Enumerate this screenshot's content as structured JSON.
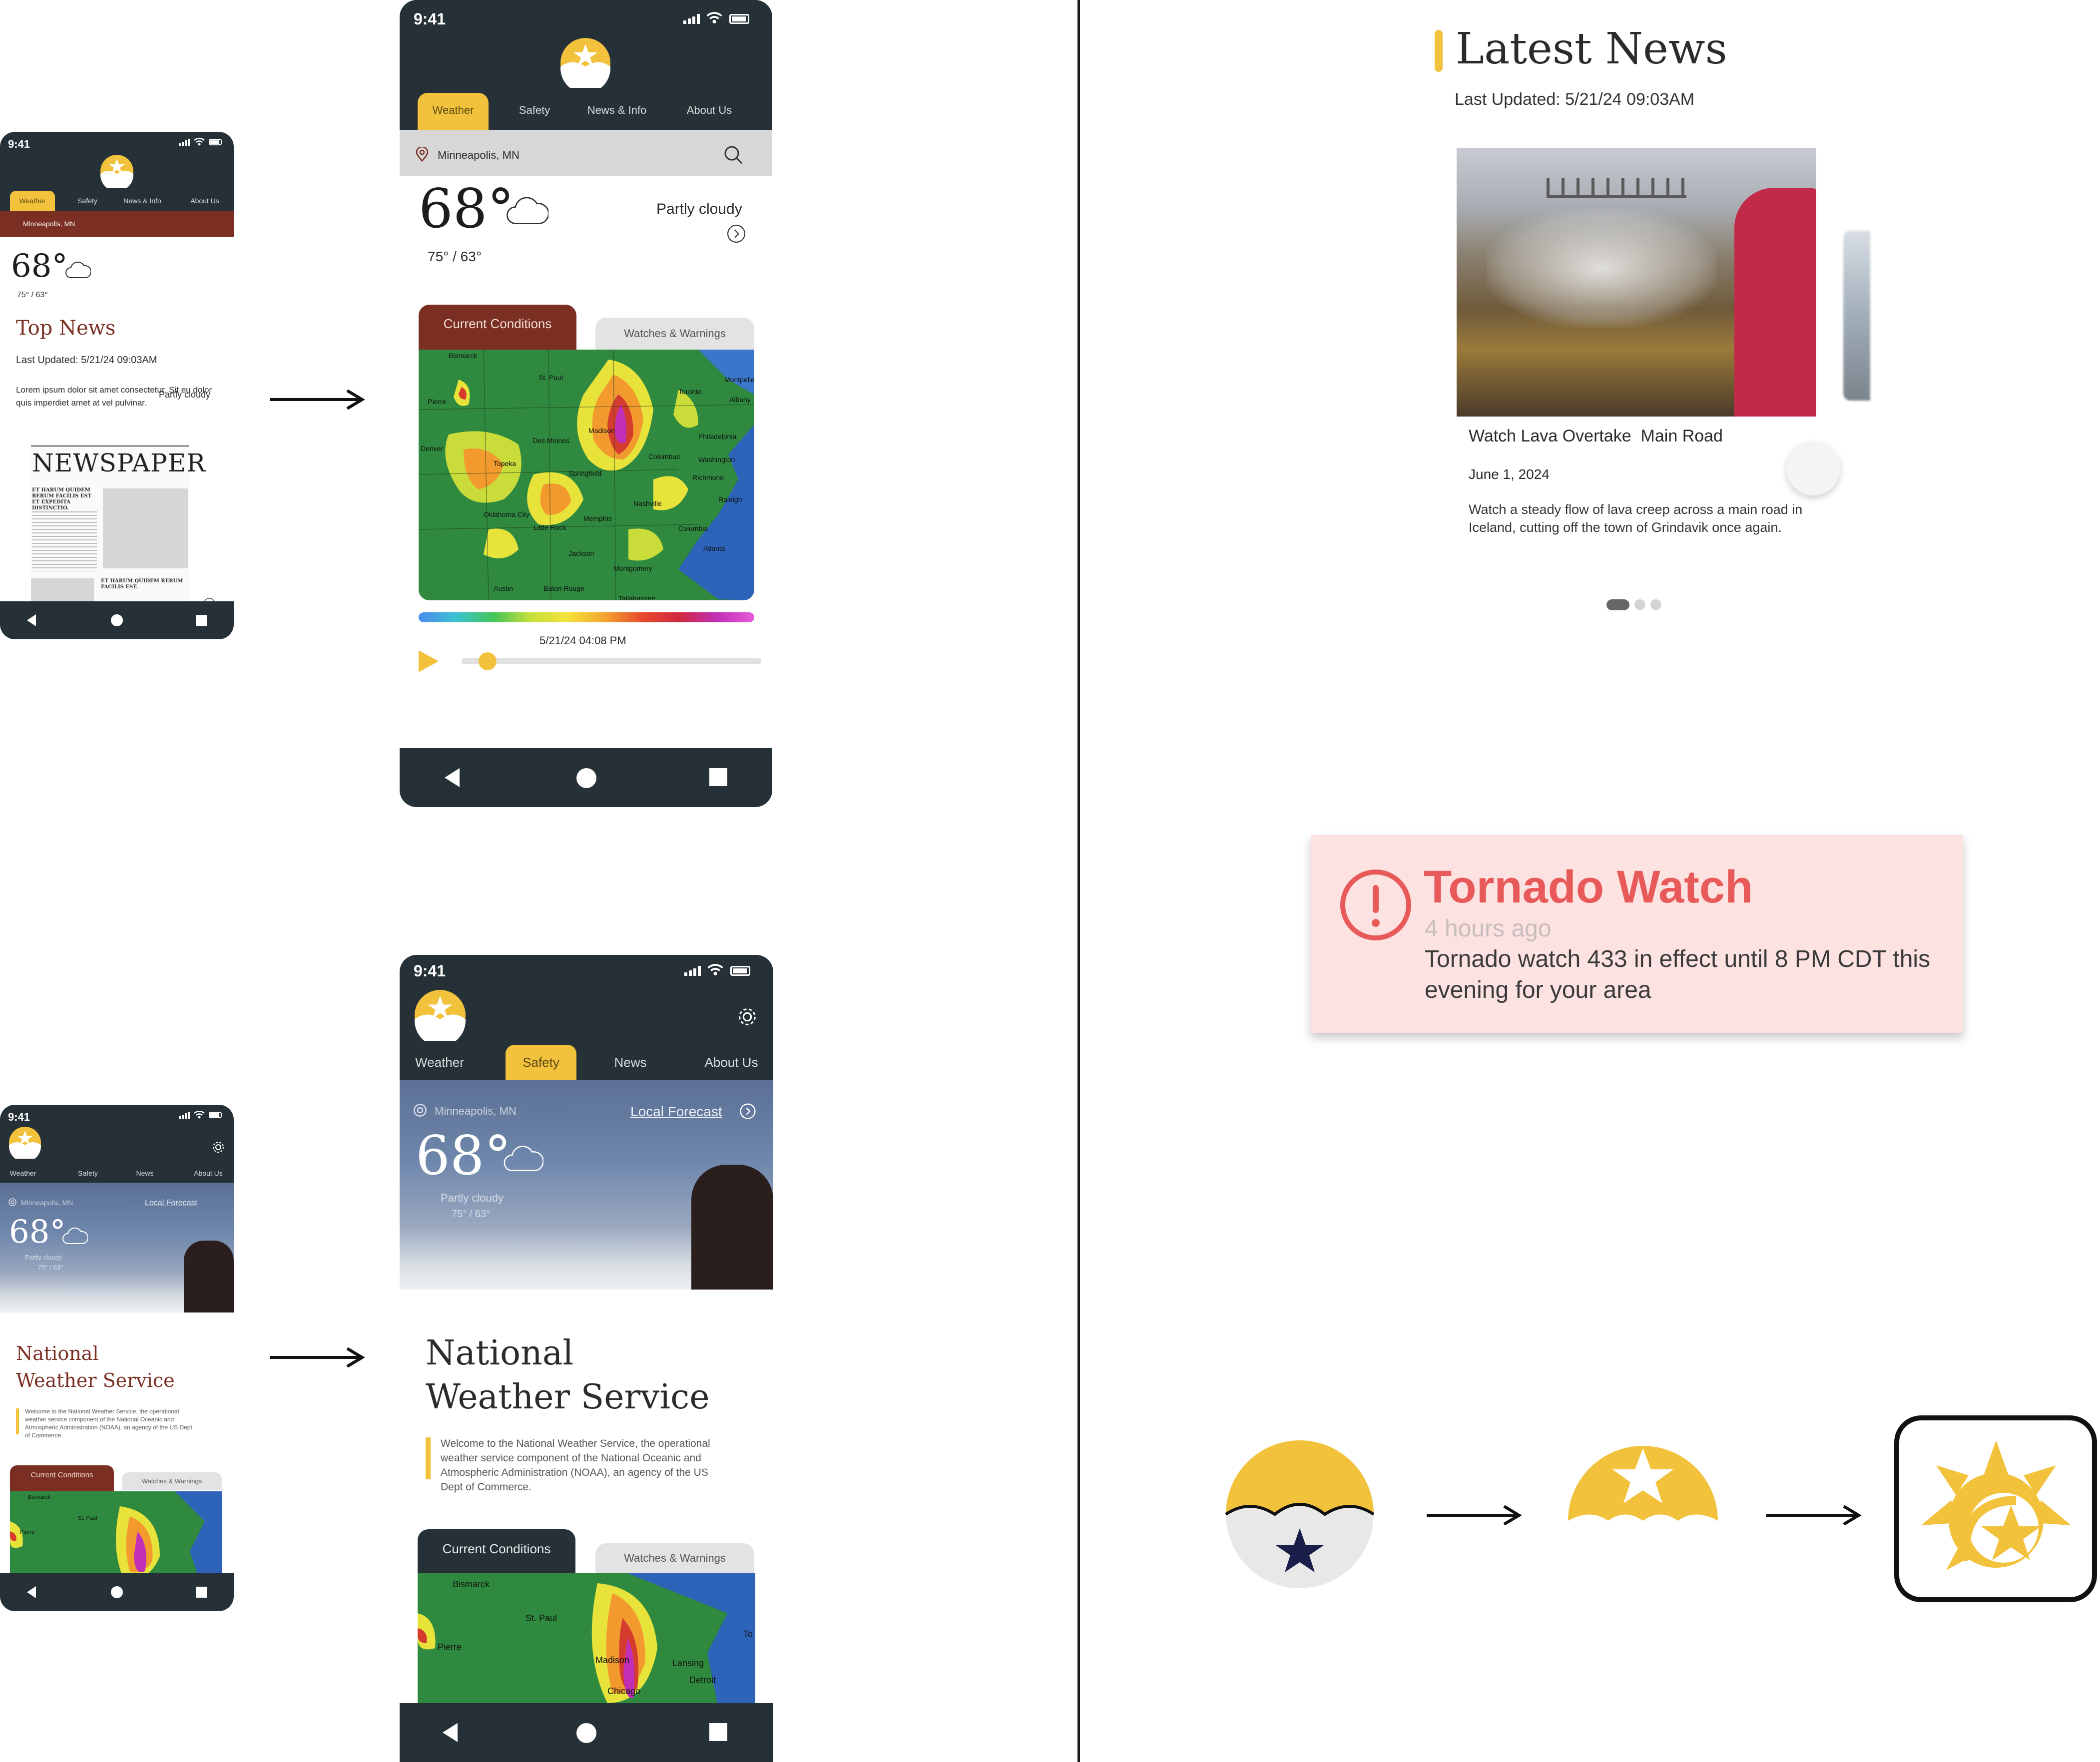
{
  "status_time": "9:41",
  "phone1": {
    "tabs": [
      "Weather",
      "Safety",
      "News & Info",
      "About Us"
    ],
    "location": "Minneapolis, MN",
    "temp": "68°",
    "hilo": "75° / 63°",
    "condition": "Partly cloudy",
    "section_title": "Top News",
    "last_updated": "Last Updated: 5/21/24 09:03AM",
    "body": "Lorem ipsum dolor sit amet consectetur. Sit eu dolor quis imperdiet amet at vel pulvinar.",
    "newspaper_title": "NEWSPAPER",
    "newspaper_head1": "ET HARUM QUIDEM RERUM FACILIS EST ET EXPEDITA DISTINCTIO.",
    "newspaper_head2": "ET HARUM QUIDEM RERUM FACILIS EST."
  },
  "phone2": {
    "tabs": [
      "Weather",
      "Safety",
      "News & Info",
      "About Us"
    ],
    "location": "Minneapolis, MN",
    "temp": "68°",
    "hilo": "75° / 63°",
    "condition": "Partly cloudy",
    "card_tabs": [
      "Current Conditions",
      "Watches & Warnings"
    ],
    "timestamp": "5/21/24 04:08 PM",
    "map_labels": [
      "Bismarck",
      "St. Paul",
      "Pierre",
      "Toronto",
      "Montpelier",
      "Albany",
      "Des Moines",
      "Madison",
      "Denver",
      "Topeka",
      "Springfield",
      "Columbus",
      "Philadelphia",
      "Washington",
      "Richmond",
      "Raleigh",
      "Oklahoma City",
      "Nashville",
      "Memphis",
      "Little Rock",
      "Columbia",
      "Atlanta",
      "Jackson",
      "Montgomery",
      "Austin",
      "Baton Rouge",
      "Tallahassee"
    ]
  },
  "news": {
    "title": "Latest News",
    "last_updated": "Last Updated: 5/21/24 09:03AM",
    "headline": "Watch Lava Overtake  Main Road",
    "date": "June 1, 2024",
    "body": "Watch a steady flow of lava creep across a main road in Iceland, cutting off the town of Grindavik once again."
  },
  "alert": {
    "title": "Tornado Watch",
    "time": "4 hours ago",
    "body": "Tornado watch 433 in effect until 8 PM CDT this evening for your area"
  },
  "phone3": {
    "tabs": [
      "Weather",
      "Safety",
      "News",
      "About Us"
    ],
    "location": "Minneapolis, MN",
    "local_forecast": "Local Forecast",
    "temp": "68°",
    "condition": "Partly cloudy",
    "hilo": "75° / 63°",
    "title_line1": "National",
    "title_line2": "Weather Service",
    "intro": "Welcome to the National Weather Service, the operational weather service component of the National Oceanic and Atmospheric Administration (NOAA), an agency of the US Dept of Commerce.",
    "card_tabs": [
      "Current Conditions",
      "Watches & Warnings"
    ],
    "map_labels": [
      "Bismarck",
      "St. Paul",
      "Pierre"
    ]
  },
  "phone4": {
    "tabs": [
      "Weather",
      "Safety",
      "News",
      "About Us"
    ],
    "location": "Minneapolis, MN",
    "local_forecast": "Local Forecast",
    "temp": "68°",
    "condition": "Partly cloudy",
    "hilo": "75° / 63°",
    "title_line1": "National",
    "title_line2": "Weather Service",
    "intro": "Welcome to the National Weather Service, the operational weather service component of the National Oceanic and Atmospheric Administration (NOAA), an agency of the US Dept of Commerce.",
    "card_tabs": [
      "Current Conditions",
      "Watches & Warnings"
    ],
    "map_labels": [
      "Bismarck",
      "St. Paul",
      "Pierre",
      "Madison",
      "Lansing",
      "Chicago",
      "Detroit",
      "To"
    ]
  },
  "colors": {
    "dark": "#253136",
    "accent": "#f2c23d",
    "maroon": "#6b2a22",
    "alert_red": "#e85a5a",
    "alert_bg": "#fde2e2"
  },
  "icons": [
    "signal-icon",
    "wifi-icon",
    "battery-icon",
    "logo-icon",
    "location-pin-icon",
    "search-icon",
    "cloud-icon",
    "chevron-circle-icon",
    "play-icon",
    "gear-icon",
    "alert-circle-icon",
    "star-icon"
  ]
}
